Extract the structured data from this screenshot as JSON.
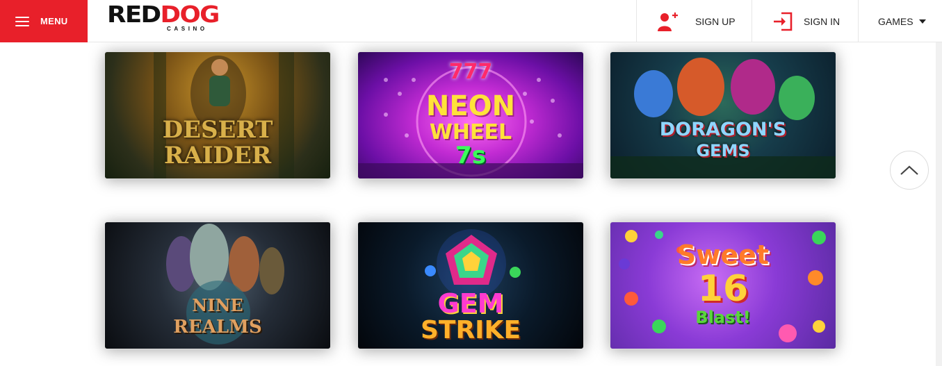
{
  "header": {
    "menu_label": "MENU",
    "logo": {
      "main_black": "RED",
      "main_red": "DOG",
      "sub": "CASINO"
    },
    "nav": {
      "signup_label": "SIGN UP",
      "signin_label": "SIGN IN",
      "games_label": "GAMES"
    },
    "icons": {
      "menu": "hamburger-icon",
      "signup": "add-user-icon",
      "signin": "sign-in-icon",
      "games": "caret-down-icon"
    }
  },
  "games": [
    {
      "title_line1": "DESERT",
      "title_line2": "RAIDER"
    },
    {
      "title_top": "777",
      "title_line1": "NEON",
      "title_line2": "WHEEL",
      "title_line3": "7s"
    },
    {
      "title_line1": "DORAGON'S",
      "title_line2": "GEMS"
    },
    {
      "title_line1": "NINE",
      "title_line2": "REALMS"
    },
    {
      "title_line1": "GEM",
      "title_line2": "STRIKE"
    },
    {
      "title_line1": "Sweet",
      "title_line2": "16",
      "title_line3": "Blast!"
    }
  ],
  "scroll_top": {
    "icon": "chevron-up-icon"
  },
  "colors": {
    "brand_red": "#e8202a"
  }
}
